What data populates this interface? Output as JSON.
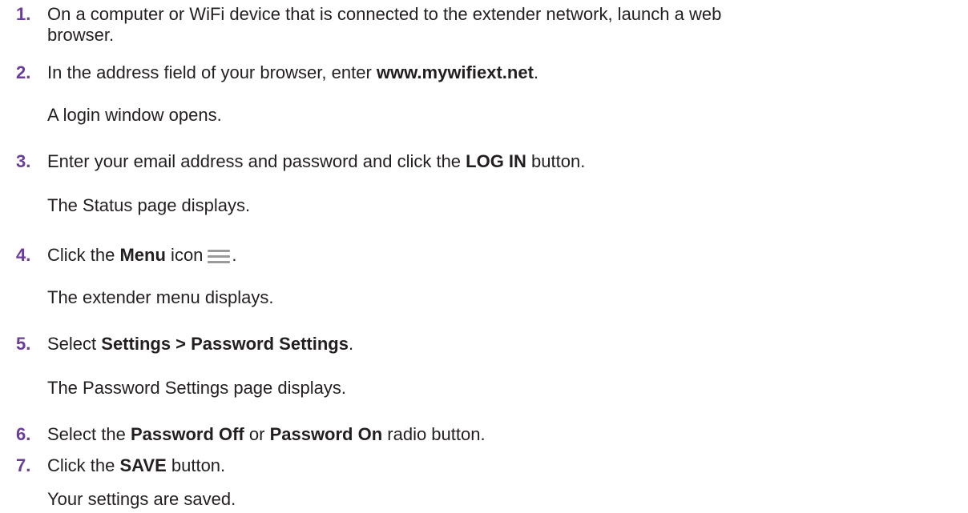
{
  "steps": [
    {
      "num": "1.",
      "line1": "On a computer or WiFi device that is connected to the extender network, launch a web",
      "line2": "browser."
    },
    {
      "num": "2.",
      "pre": "In the address field of your browser, enter ",
      "bold": "www.mywifiext.net",
      "post": ".",
      "result": "A login window opens."
    },
    {
      "num": "3.",
      "pre": "Enter your email address and password and click the ",
      "bold": "LOG IN",
      "post": " button.",
      "result": "The Status page displays."
    },
    {
      "num": "4.",
      "pre": "Click the ",
      "bold": "Menu",
      "post": " icon",
      "post2": ".",
      "icon": "hamburger-menu-icon",
      "result": "The extender menu displays."
    },
    {
      "num": "5.",
      "pre": "Select ",
      "bold": "Settings > Password Settings",
      "post": ".",
      "result": "The Password Settings page displays."
    },
    {
      "num": "6.",
      "pre": "Select the ",
      "bold": "Password Off",
      "mid": " or ",
      "bold2": "Password On",
      "post": " radio button."
    },
    {
      "num": "7.",
      "pre": "Click the ",
      "bold": "SAVE",
      "post": " button.",
      "result": "Your settings are saved."
    }
  ],
  "colors": {
    "step_number": "#6a3d9a",
    "text": "#231f20",
    "icon": "#9a9a9a"
  }
}
